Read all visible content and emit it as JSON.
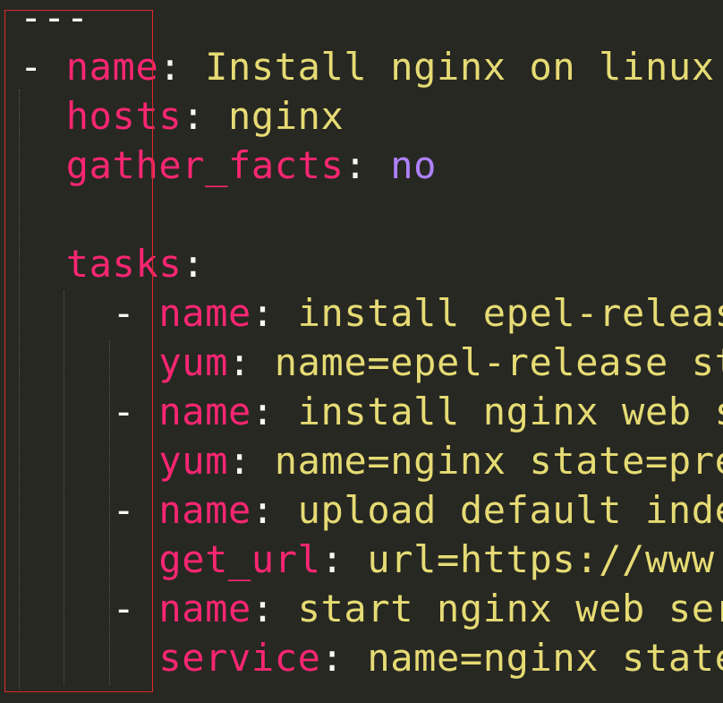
{
  "colors": {
    "background": "#272822",
    "key": "#F92672",
    "string": "#E6DB74",
    "boolean": "#AE81FF",
    "punctuation": "#F8F8F2",
    "highlight_box": "#E0282E"
  },
  "code": {
    "doc_start": "---",
    "play": {
      "dash": "- ",
      "name_key": "name",
      "name_value": "Install nginx on linux",
      "hosts_key": "hosts",
      "hosts_value": "nginx",
      "gather_facts_key": "gather_facts",
      "gather_facts_value": "no",
      "tasks_key": "tasks"
    },
    "tasks": [
      {
        "dash": "- ",
        "name_key": "name",
        "name_value": "install epel-releas",
        "module_key": "yum",
        "module_value": "name=epel-release st"
      },
      {
        "dash": "- ",
        "name_key": "name",
        "name_value": "install nginx web s",
        "module_key": "yum",
        "module_value": "name=nginx state=pre"
      },
      {
        "dash": "- ",
        "name_key": "name",
        "name_value": "upload default inde",
        "module_key": "get_url",
        "module_value": "url=https://www."
      },
      {
        "dash": "- ",
        "name_key": "name",
        "name_value": "start nginx web ser",
        "module_key": "service",
        "module_value": "name=nginx state"
      }
    ]
  }
}
